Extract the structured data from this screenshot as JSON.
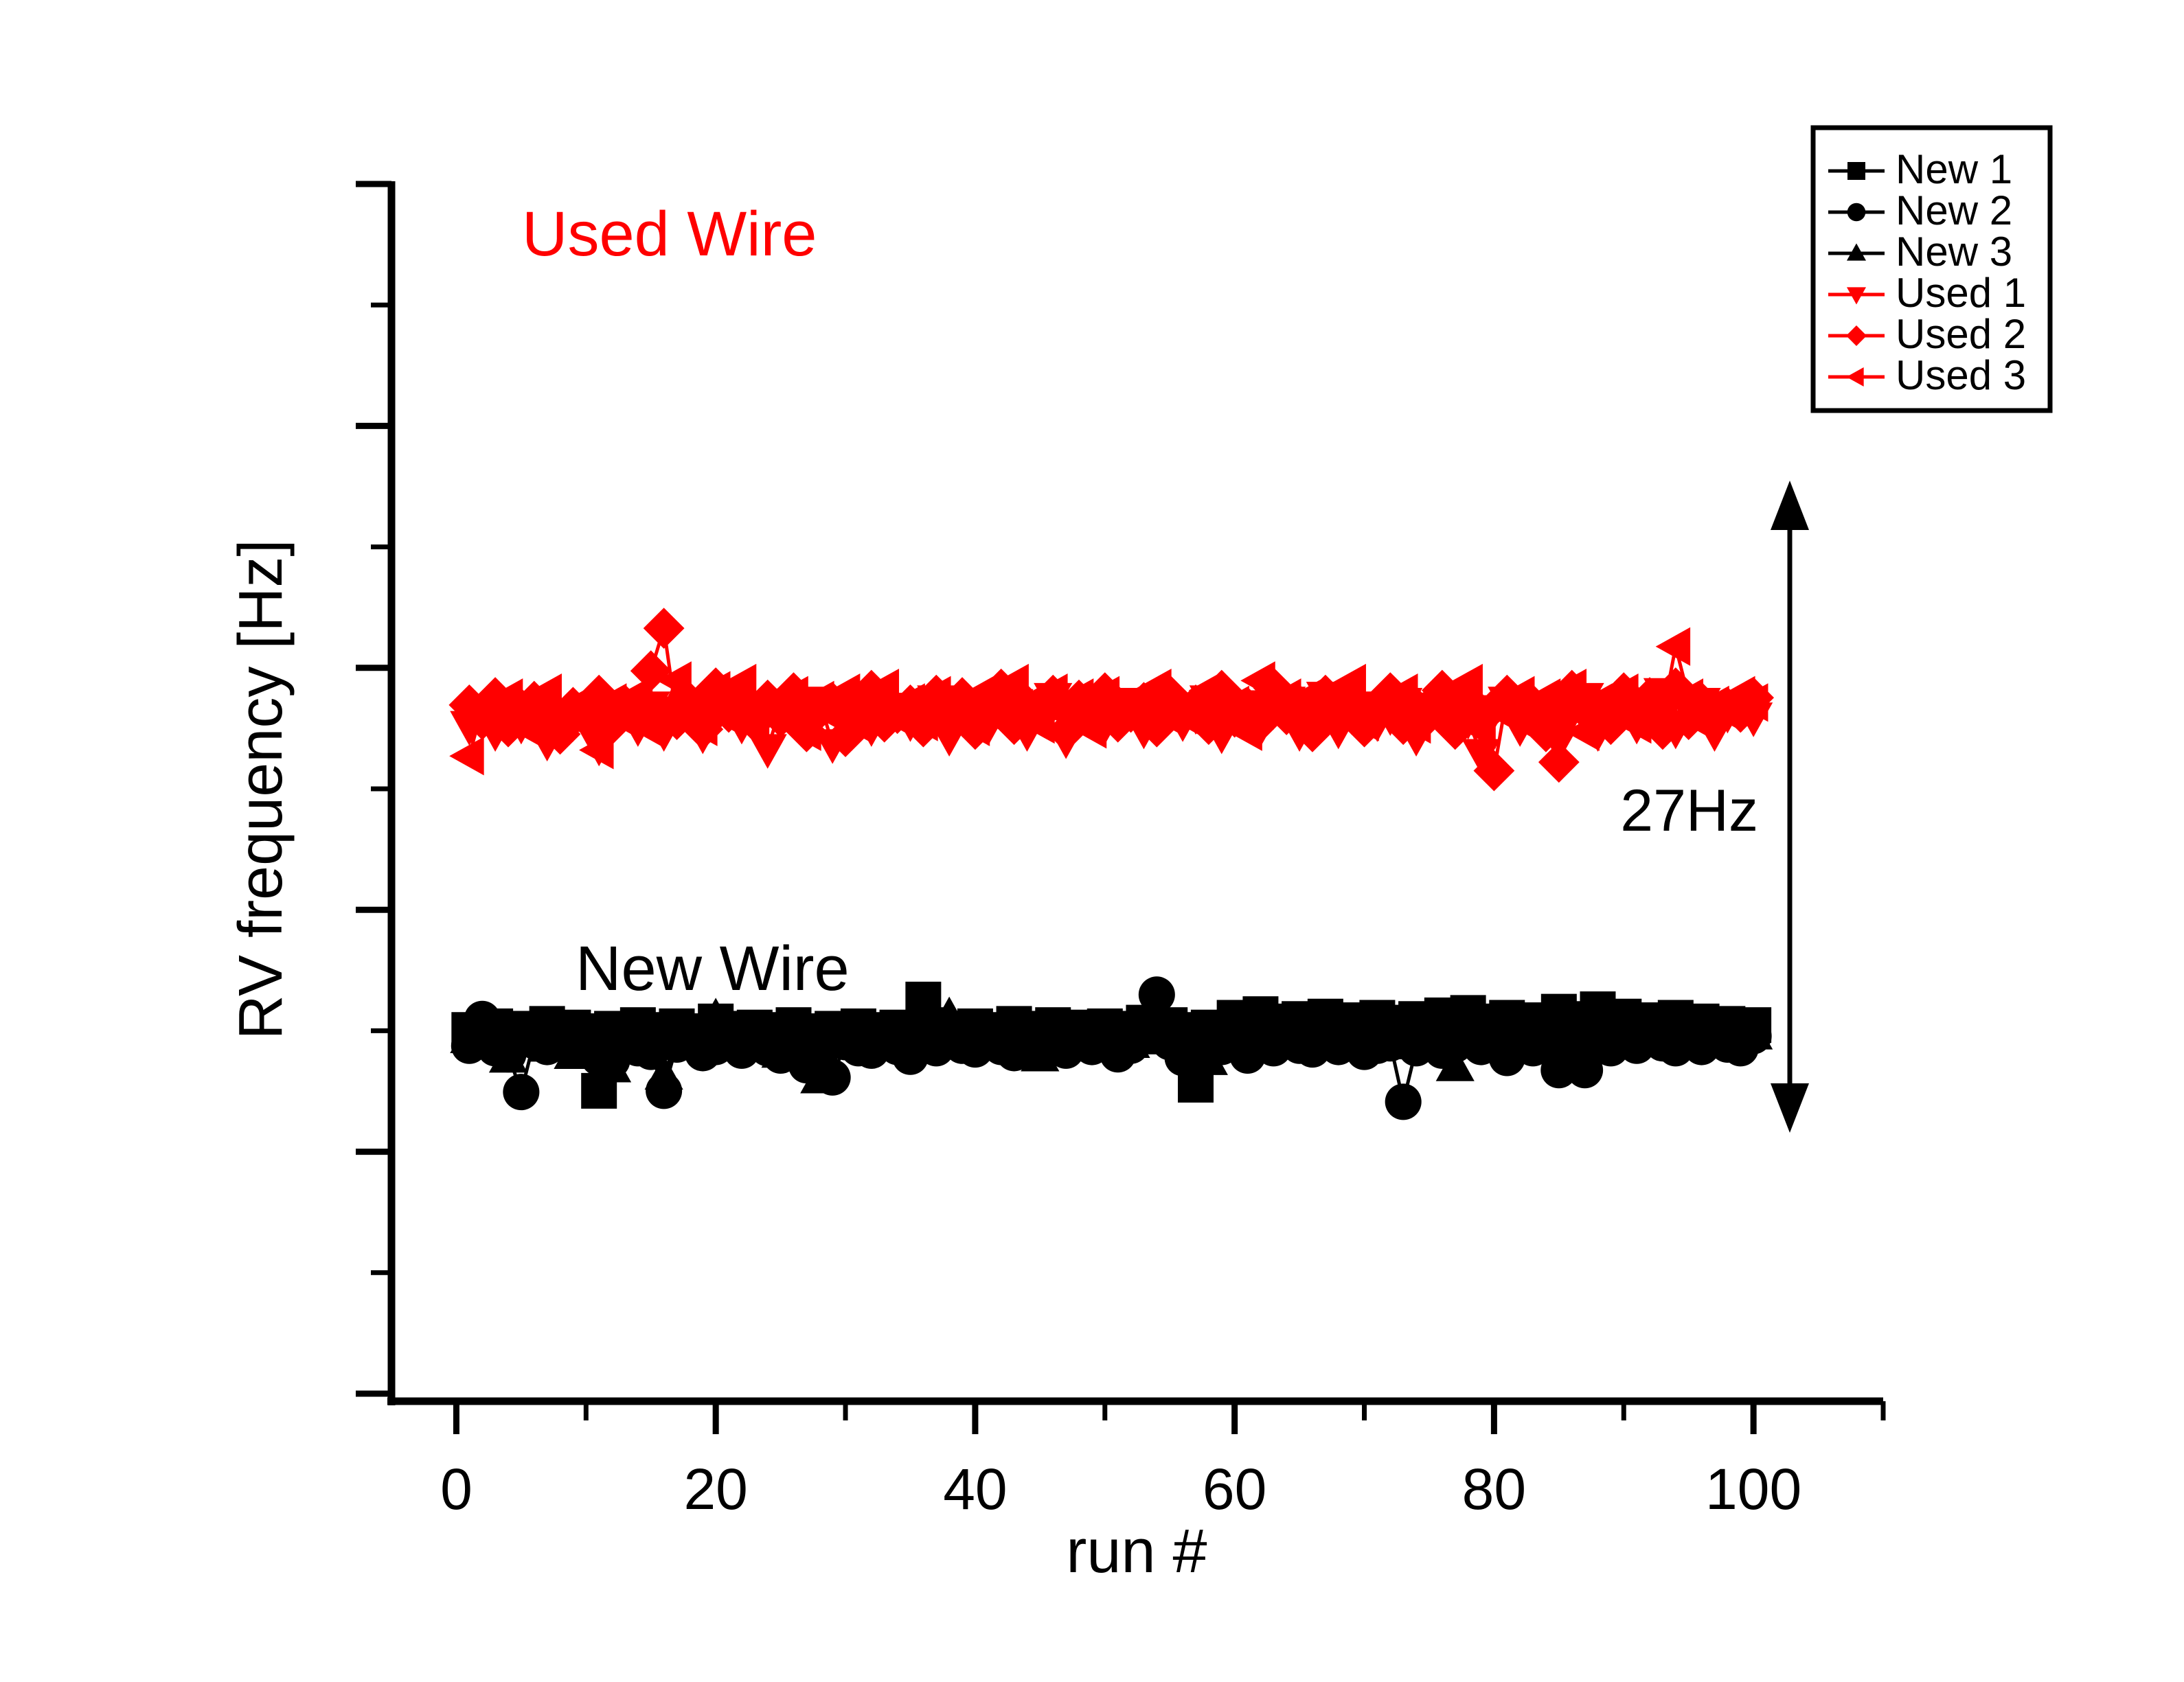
{
  "figure": {
    "background_color": "#FFFFFF",
    "black_color": "#000000",
    "red_color": "#FF0000"
  },
  "annotations": {
    "used_wire_label": "Used Wire",
    "new_wire_label": "New Wire",
    "gap_label": "27Hz"
  },
  "legend": {
    "entries": [
      {
        "label": "New 1",
        "color": "#000000",
        "marker": "square"
      },
      {
        "label": "New 2",
        "color": "#000000",
        "marker": "circle"
      },
      {
        "label": "New 3",
        "color": "#000000",
        "marker": "triangle-up"
      },
      {
        "label": "Used 1",
        "color": "#FF0000",
        "marker": "triangle-down"
      },
      {
        "label": "Used 2",
        "color": "#FF0000",
        "marker": "diamond"
      },
      {
        "label": "Used 3",
        "color": "#FF0000",
        "marker": "triangle-left"
      }
    ]
  },
  "chart_data": {
    "type": "line",
    "title": "",
    "xlabel": "run #",
    "ylabel": "RV frequency [Hz]",
    "xlim": [
      -5,
      110
    ],
    "ylim": [
      0,
      100
    ],
    "xticks": [
      0,
      20,
      40,
      60,
      80,
      100
    ],
    "xtick_labels": [
      "0",
      "20",
      "40",
      "60",
      "80",
      "100"
    ],
    "x_minor_tick_interval": 10,
    "yticks_unlabeled": true,
    "y_major_tick_count": 6,
    "y_minor_between_majors": 1,
    "grid": false,
    "legend_position": "top-right-outside",
    "group_separation_hz": 27,
    "x": [
      1,
      2,
      3,
      4,
      5,
      6,
      7,
      8,
      9,
      10,
      11,
      12,
      13,
      14,
      15,
      16,
      17,
      18,
      19,
      20,
      21,
      22,
      23,
      24,
      25,
      26,
      27,
      28,
      29,
      30,
      31,
      32,
      33,
      34,
      35,
      36,
      37,
      38,
      39,
      40,
      41,
      42,
      43,
      44,
      45,
      46,
      47,
      48,
      49,
      50,
      51,
      52,
      53,
      54,
      55,
      56,
      57,
      58,
      59,
      60,
      61,
      62,
      63,
      64,
      65,
      66,
      67,
      68,
      69,
      70,
      71,
      72,
      73,
      74,
      75,
      76,
      77,
      78,
      79,
      80,
      81,
      82,
      83,
      84,
      85,
      86,
      87,
      88,
      89,
      90,
      91,
      92,
      93,
      94,
      95,
      96,
      97,
      98,
      99,
      100
    ],
    "series": [
      {
        "name": "New 1",
        "color": "#000000",
        "marker": "square",
        "group": "New Wire",
        "values": [
          30.5,
          30.0,
          30.8,
          30.2,
          30.6,
          30.1,
          31.0,
          30.3,
          30.7,
          30.4,
          25.5,
          30.6,
          30.2,
          30.9,
          30.5,
          30.0,
          30.8,
          30.4,
          30.3,
          31.2,
          30.6,
          30.1,
          30.7,
          30.5,
          30.2,
          30.9,
          30.4,
          28.8,
          30.6,
          30.3,
          30.8,
          30.5,
          30.1,
          30.7,
          30.4,
          33.0,
          30.9,
          30.6,
          30.2,
          30.8,
          30.5,
          30.3,
          31.0,
          30.6,
          30.4,
          30.9,
          30.2,
          30.7,
          30.5,
          30.8,
          30.3,
          30.6,
          31.1,
          30.4,
          30.9,
          30.5,
          26.0,
          30.7,
          30.3,
          31.5,
          30.6,
          31.8,
          31.2,
          30.9,
          31.4,
          30.7,
          31.6,
          31.0,
          31.3,
          30.8,
          31.5,
          31.1,
          30.6,
          31.4,
          31.0,
          31.7,
          30.9,
          31.9,
          31.2,
          30.8,
          31.5,
          31.0,
          31.3,
          30.7,
          32.0,
          31.4,
          30.9,
          32.2,
          31.1,
          31.6,
          30.8,
          31.3,
          30.6,
          31.5,
          30.9,
          31.2,
          29.8,
          31.0,
          30.7,
          30.9
        ]
      },
      {
        "name": "New 2",
        "color": "#000000",
        "marker": "circle",
        "group": "New Wire",
        "values": [
          29.2,
          31.4,
          29.0,
          28.5,
          25.4,
          29.6,
          29.1,
          30.7,
          28.9,
          29.4,
          28.2,
          28.0,
          29.5,
          29.0,
          28.7,
          25.5,
          29.3,
          29.8,
          28.6,
          29.1,
          29.4,
          28.8,
          30.2,
          29.0,
          28.4,
          29.7,
          27.6,
          29.2,
          26.6,
          29.5,
          29.0,
          28.8,
          29.6,
          29.1,
          28.3,
          29.4,
          29.0,
          29.8,
          29.2,
          28.9,
          29.5,
          29.1,
          28.6,
          29.3,
          29.7,
          29.0,
          28.8,
          29.4,
          29.1,
          29.6,
          28.5,
          29.2,
          31.0,
          33.4,
          29.5,
          28.2,
          29.0,
          29.6,
          29.1,
          29.8,
          28.4,
          29.3,
          29.0,
          29.7,
          29.2,
          28.9,
          29.5,
          29.1,
          29.6,
          28.7,
          29.2,
          29.4,
          24.6,
          29.0,
          29.5,
          28.8,
          29.3,
          29.9,
          29.1,
          29.6,
          28.2,
          29.4,
          29.0,
          29.7,
          27.2,
          29.3,
          27.2,
          29.5,
          29.0,
          29.8,
          29.2,
          30.9,
          29.4,
          29.0,
          29.6,
          29.1,
          29.7,
          29.3,
          29.0,
          30.0
        ]
      },
      {
        "name": "New 3",
        "color": "#000000",
        "marker": "triangle-up",
        "group": "New Wire",
        "values": [
          29.8,
          29.4,
          30.1,
          28.2,
          29.6,
          30.4,
          29.1,
          29.9,
          28.5,
          30.2,
          29.5,
          27.4,
          30.0,
          29.3,
          29.8,
          26.8,
          29.6,
          30.5,
          29.2,
          31.5,
          29.7,
          30.0,
          29.4,
          29.9,
          28.6,
          30.3,
          29.5,
          26.5,
          29.8,
          30.1,
          29.4,
          30.6,
          29.2,
          29.9,
          30.4,
          29.6,
          30.0,
          31.6,
          29.3,
          29.8,
          30.2,
          29.5,
          30.1,
          29.7,
          28.3,
          30.4,
          29.6,
          30.0,
          29.3,
          29.9,
          30.5,
          29.4,
          30.2,
          29.7,
          30.0,
          29.5,
          30.3,
          28.0,
          29.8,
          30.1,
          29.4,
          30.6,
          29.9,
          30.2,
          29.6,
          30.0,
          31.2,
          29.5,
          30.4,
          29.8,
          30.1,
          29.3,
          29.9,
          30.5,
          29.6,
          30.2,
          27.5,
          30.0,
          29.4,
          30.8,
          29.7,
          30.3,
          29.5,
          30.1,
          29.8,
          30.4,
          29.6,
          30.9,
          29.3,
          30.0,
          29.7,
          30.5,
          29.9,
          30.2,
          29.5,
          30.0,
          29.6,
          30.7,
          29.8,
          30.1
        ]
      },
      {
        "name": "Used 1",
        "color": "#FF0000",
        "marker": "triangle-down",
        "group": "Used Wire",
        "values": [
          55.5,
          56.4,
          55.0,
          56.8,
          55.6,
          57.0,
          54.2,
          56.2,
          55.8,
          56.5,
          53.8,
          56.0,
          56.9,
          55.4,
          57.1,
          55.0,
          56.6,
          57.4,
          54.8,
          56.2,
          57.8,
          55.6,
          56.4,
          53.6,
          57.0,
          56.1,
          55.2,
          57.5,
          54.0,
          56.8,
          57.2,
          55.4,
          56.6,
          57.0,
          55.8,
          56.4,
          57.6,
          54.6,
          56.2,
          57.0,
          55.5,
          56.8,
          57.3,
          55.0,
          56.5,
          57.8,
          54.4,
          56.9,
          57.1,
          55.6,
          56.3,
          57.4,
          55.2,
          56.7,
          57.0,
          55.8,
          56.4,
          57.6,
          54.8,
          56.2,
          57.2,
          55.4,
          56.8,
          57.5,
          55.0,
          56.6,
          57.9,
          55.2,
          56.4,
          57.1,
          55.8,
          56.3,
          57.4,
          54.6,
          56.9,
          57.2,
          55.5,
          56.0,
          53.2,
          56.8,
          57.5,
          55.4,
          56.2,
          57.0,
          54.2,
          56.6,
          57.8,
          55.0,
          56.4,
          57.2,
          55.6,
          56.0,
          58.2,
          55.2,
          56.8,
          57.4,
          55.0,
          56.5,
          57.1,
          56.2
        ]
      },
      {
        "name": "Used 2",
        "color": "#FF0000",
        "marker": "diamond",
        "group": "Used Wire",
        "values": [
          57.2,
          56.0,
          57.8,
          55.4,
          56.9,
          57.5,
          56.2,
          54.8,
          57.0,
          56.4,
          58.0,
          55.6,
          57.2,
          56.8,
          60.0,
          63.5,
          56.0,
          57.4,
          55.2,
          58.6,
          56.6,
          57.0,
          55.8,
          57.6,
          56.2,
          58.2,
          55.0,
          56.8,
          57.4,
          54.6,
          57.0,
          58.4,
          55.8,
          56.5,
          57.2,
          55.4,
          58.0,
          56.6,
          57.8,
          55.2,
          56.9,
          58.5,
          55.6,
          57.2,
          56.4,
          58.0,
          55.0,
          57.6,
          56.2,
          58.2,
          55.8,
          56.6,
          57.4,
          55.4,
          58.0,
          56.8,
          57.2,
          55.6,
          58.4,
          56.2,
          57.0,
          55.8,
          58.6,
          56.4,
          57.2,
          55.0,
          58.0,
          56.6,
          57.8,
          55.4,
          56.9,
          58.2,
          55.6,
          57.0,
          56.4,
          58.4,
          55.2,
          57.6,
          56.0,
          51.8,
          58.0,
          56.4,
          57.2,
          55.0,
          52.5,
          58.4,
          56.8,
          57.0,
          55.6,
          58.2,
          56.4,
          57.8,
          55.2,
          58.6,
          56.0,
          57.4,
          55.8,
          57.0,
          56.6,
          57.8
        ]
      },
      {
        "name": "Used 3",
        "color": "#FF0000",
        "marker": "triangle-left",
        "group": "Used Wire",
        "values": [
          53.0,
          57.0,
          55.5,
          57.8,
          56.2,
          55.0,
          58.2,
          56.4,
          57.0,
          55.6,
          53.5,
          57.4,
          56.0,
          58.0,
          55.2,
          56.8,
          59.2,
          57.0,
          55.4,
          58.4,
          56.2,
          59.0,
          55.8,
          57.2,
          56.6,
          58.0,
          55.0,
          57.6,
          56.4,
          58.2,
          55.6,
          57.0,
          58.6,
          56.2,
          57.4,
          55.8,
          58.0,
          56.6,
          57.2,
          55.4,
          58.4,
          56.0,
          59.0,
          57.2,
          55.6,
          58.2,
          56.4,
          57.8,
          55.2,
          58.0,
          56.8,
          57.4,
          55.6,
          58.6,
          56.2,
          57.0,
          55.8,
          58.4,
          56.4,
          57.2,
          55.0,
          59.2,
          56.6,
          57.8,
          55.4,
          58.0,
          56.2,
          57.4,
          59.0,
          55.8,
          57.0,
          56.4,
          58.2,
          55.6,
          57.6,
          56.0,
          58.4,
          59.0,
          55.2,
          57.0,
          56.6,
          58.0,
          55.4,
          57.8,
          56.2,
          58.6,
          55.0,
          57.4,
          56.8,
          58.2,
          55.6,
          57.0,
          56.4,
          62.0,
          57.8,
          55.8,
          57.2,
          56.6,
          58.0,
          57.4
        ]
      }
    ]
  }
}
